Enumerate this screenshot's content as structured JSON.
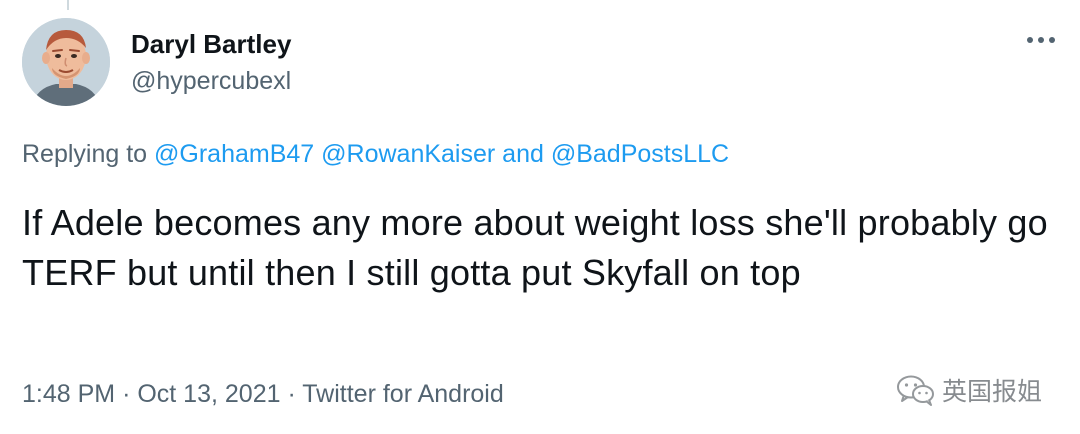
{
  "tweet": {
    "author_name": "Daryl Bartley",
    "author_handle": "@hypercubexl",
    "replying_to_prefix": "Replying to",
    "mentions": [
      "@GrahamB47",
      "@RowanKaiser",
      "@BadPostsLLC"
    ],
    "mention_joiner": "and",
    "text": "If Adele becomes any more about weight loss she'll probably go TERF but until then I still gotta put Skyfall on top",
    "time": "1:48 PM",
    "date": "Oct 13, 2021",
    "source": "Twitter for Android",
    "separator": "·"
  },
  "watermark": {
    "label": "英国报姐",
    "icon": "wechat-icon"
  },
  "colors": {
    "link": "#1d9bf0",
    "secondary_text": "#536471",
    "primary_text": "#0f1419"
  },
  "icons": {
    "more": "more-dots-icon",
    "avatar": "memoji-avatar"
  }
}
